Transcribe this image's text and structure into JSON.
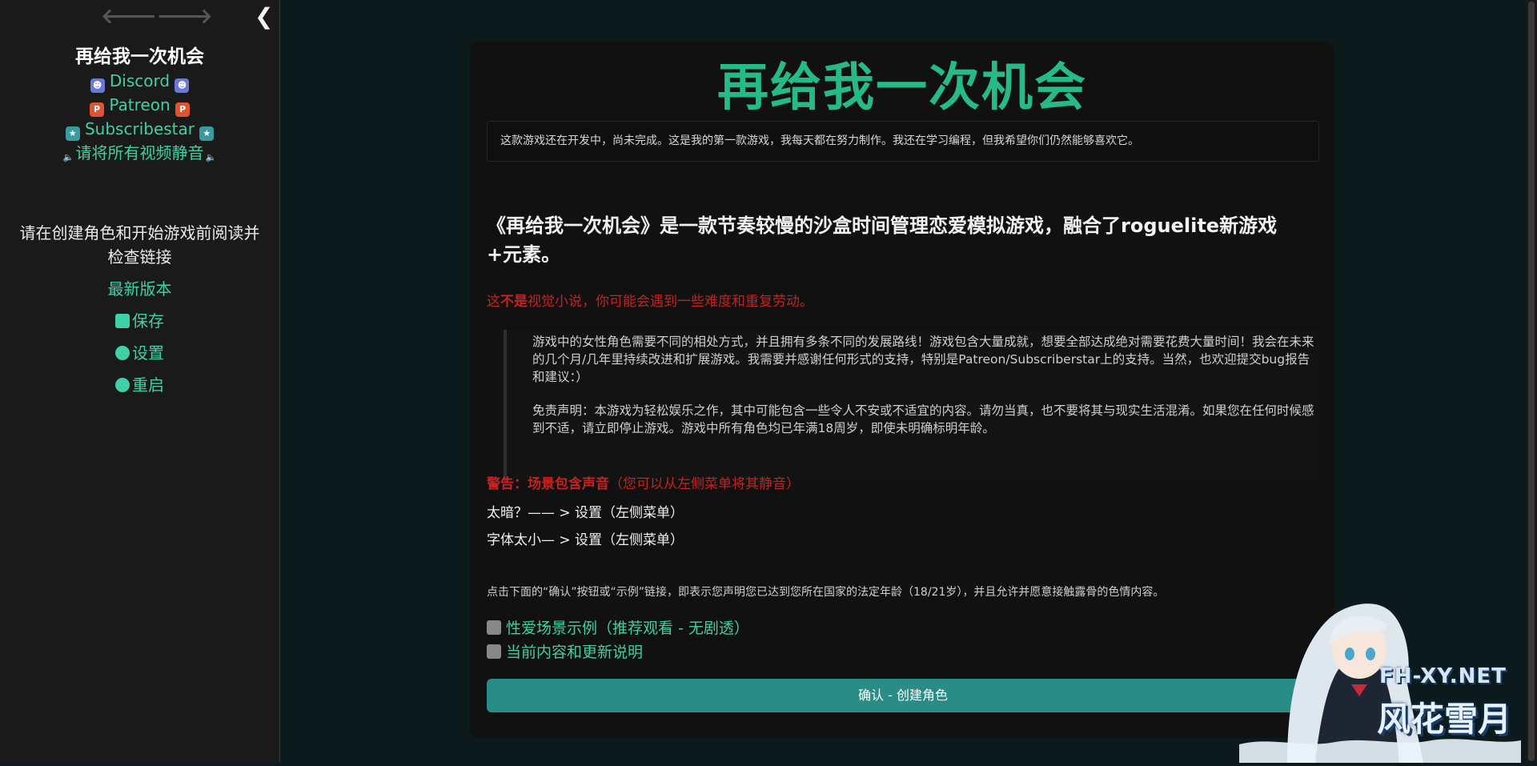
{
  "sidebar": {
    "back_glyph": "🡐",
    "forward_glyph": "🡒",
    "collapse_glyph": "❮",
    "story_title": "再给我一次机会",
    "links": [
      {
        "label": "Discord",
        "icon": "discord-icon"
      },
      {
        "label": "Patreon",
        "icon": "patreon-icon"
      },
      {
        "label": "Subscribestar",
        "icon": "subscribestar-icon"
      },
      {
        "label": "请将所有视频静音",
        "icon": "mute-icon"
      }
    ],
    "note": "请在创建角色和开始游戏前阅读并检查链接",
    "menu": [
      {
        "label": "最新版本"
      },
      {
        "label": "保存",
        "icon": "save-icon"
      },
      {
        "label": "设置",
        "icon": "gear-icon"
      },
      {
        "label": "重启",
        "icon": "power-icon"
      }
    ]
  },
  "passage": {
    "title": "再给我一次机会",
    "dev_notice": "这款游戏还在开发中，尚未完成。这是我的第一款游戏，我每天都在努力制作。我还在学习编程，但我希望你们仍然能够喜欢它。",
    "intro_pre": "《再给我一次机会》是一款节奏",
    "intro_bold": "较慢的",
    "intro_post": "沙盒时间管理恋爱模拟游戏，融合了roguelite新游戏+元素。",
    "not_vn_pre": "这",
    "not_vn_bold": "不是",
    "not_vn_post": "视觉小说，你可能会遇到一些难度和重复劳动。",
    "quote_p1": "游戏中的女性角色需要不同的相处方式，并且拥有多条不同的发展路线！游戏包含大量成就，想要全部达成绝对需要花费大量时间！我会在未来的几个月/几年里持续改进和扩展游戏。我需要并感谢任何形式的支持，特别是Patreon/Subscriberstar上的支持。当然，也欢迎提交bug报告和建议：）",
    "quote_p2": "免责声明：本游戏为轻松娱乐之作，其中可能包含一些令人不安或不适宜的内容。请勿当真，也不要将其与现实生活混淆。如果您在任何时候感到不适，请立即停止游戏。游戏中所有角色均已年满18周岁，即使未明确标明年龄。",
    "warning_bold": "警告：场景包含声音",
    "warning_rest": "（您可以从左侧菜单将其静音）",
    "hint_dark": "太暗？—— > 设置（左侧菜单）",
    "hint_font": "字体太小— > 设置（左侧菜单）",
    "age_text": "点击下面的“确认”按钮或“示例”链接，即表示您声明您已达到您所在国家的法定年龄（18/21岁），并且允许并愿意接触露骨的色情内容。",
    "link_sample": "性爱场景示例（推荐观看 - 无剧透）",
    "link_notes": "当前内容和更新说明",
    "confirm_label": "确认 - 创建角色"
  },
  "watermark": {
    "site": "FH-XY.NET",
    "name": "风花雪月"
  },
  "colors": {
    "accent_green": "#3fd0a6",
    "title_green": "#26b98a",
    "warning_red": "#c52222",
    "button_teal": "#2a8c86"
  }
}
